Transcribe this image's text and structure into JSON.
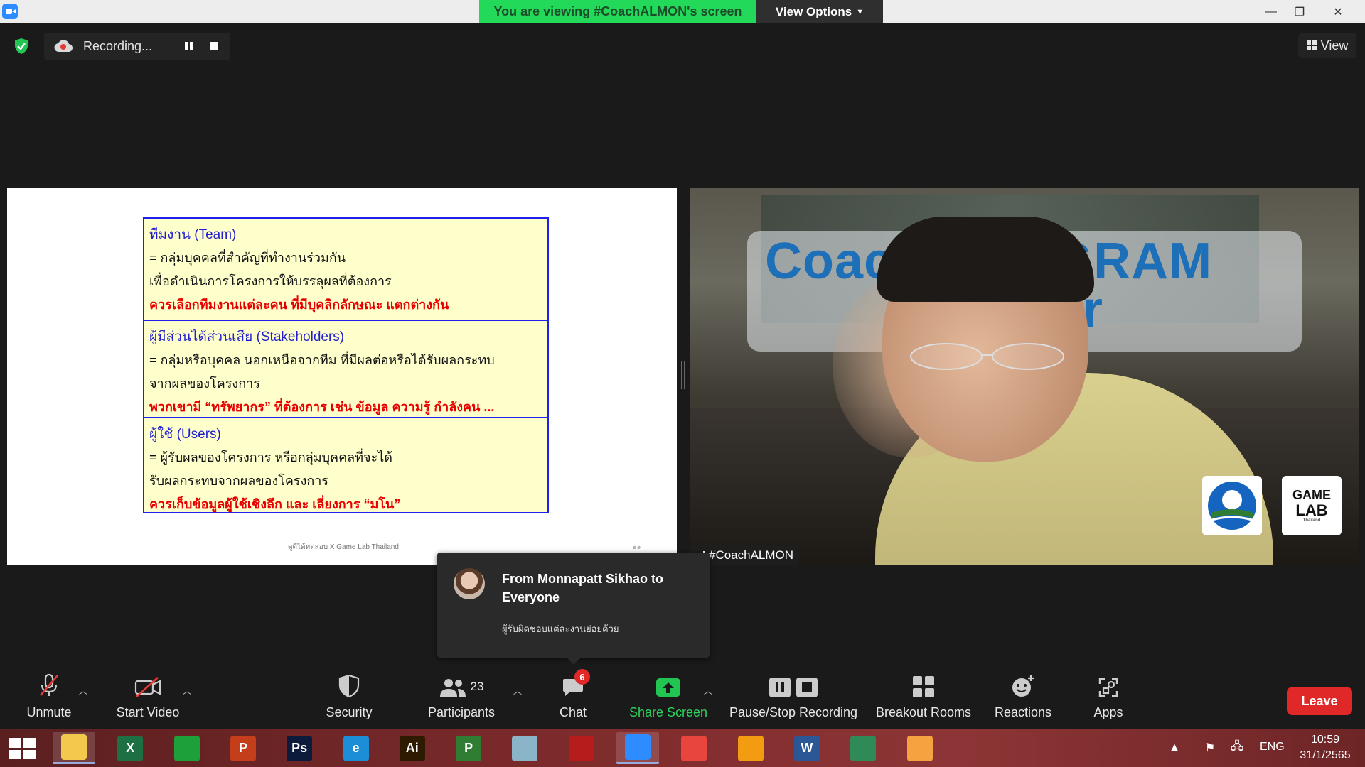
{
  "titlebar": {
    "banner": "You are viewing #CoachALMON's screen",
    "view_options": "View Options",
    "minimize": "—",
    "restore": "❐",
    "close": "✕"
  },
  "recording": {
    "label": "Recording..."
  },
  "view_button": {
    "label": "View"
  },
  "slide": {
    "sections": [
      {
        "title": "ทีมงาน (Team)",
        "lines": [
          "= กลุ่มบุคคลที่สำคัญที่ทำงานร่วมกัน",
          "เพื่อดำเนินการโครงการให้บรรลุผลที่ต้องการ"
        ],
        "highlight": "ควรเลือกทีมงานแต่ละคน ที่มีบุคลิกลักษณะ แตกต่างกัน"
      },
      {
        "title": "ผู้มีส่วนได้ส่วนเสีย (Stakeholders)",
        "lines": [
          "= กลุ่มหรือบุคคล นอกเหนือจากทีม ที่มีผลต่อหรือได้รับผลกระทบ",
          "จากผลของโครงการ"
        ],
        "highlight": "พวกเขามี “ทรัพยากร” ที่ต้องการ เช่น ข้อมูล ความรู้ กำลังคน ..."
      },
      {
        "title": "ผู้ใช้ (Users)",
        "lines": [
          "= ผู้รับผลของโครงการ หรือกลุ่มบุคคลที่จะได้",
          "รับผลกระทบจากผลของโครงการ"
        ],
        "highlight": "ควรเก็บข้อมูลผู้ใช้เชิงลึก และ เลี่ยงการ “มโน”"
      }
    ],
    "footer": "ดูดีได้ทดสอบ X Game Lab Thailand",
    "page_num": "๑๑"
  },
  "video": {
    "banner_line1": "Coach PROGRAM",
    "banner_line2": "urer",
    "participant_name": "#CoachALMON",
    "logo_text": [
      "GAME",
      "LAB",
      "Thailand"
    ]
  },
  "chat_toast": {
    "from": "From Monnapatt Sikhao to Everyone",
    "message": "ผู้รับผิดชอบแต่ละงานย่อยด้วย"
  },
  "toolbar": {
    "unmute": "Unmute",
    "start_video": "Start Video",
    "security": "Security",
    "participants": "Participants",
    "participants_count": "23",
    "chat": "Chat",
    "chat_badge": "6",
    "share_screen": "Share Screen",
    "pause_stop_recording": "Pause/Stop Recording",
    "breakout_rooms": "Breakout Rooms",
    "reactions": "Reactions",
    "apps": "Apps",
    "leave": "Leave"
  },
  "taskbar": {
    "apps": [
      {
        "name": "file-explorer",
        "label": "",
        "color": "#f2c94c"
      },
      {
        "name": "excel",
        "label": "X",
        "color": "#1d7044"
      },
      {
        "name": "store",
        "label": "",
        "color": "#1d9f3a"
      },
      {
        "name": "powerpoint",
        "label": "P",
        "color": "#c43e1c"
      },
      {
        "name": "photoshop",
        "label": "Ps",
        "color": "#0c1a3b"
      },
      {
        "name": "internet-explorer",
        "label": "e",
        "color": "#1c8ed8"
      },
      {
        "name": "illustrator",
        "label": "Ai",
        "color": "#2d1a00"
      },
      {
        "name": "project",
        "label": "P",
        "color": "#2e7d32"
      },
      {
        "name": "notes",
        "label": "",
        "color": "#8ab4c8"
      },
      {
        "name": "photoscape",
        "label": "",
        "color": "#b71c1c"
      },
      {
        "name": "zoom",
        "label": "",
        "color": "#2d8cff"
      },
      {
        "name": "chrome",
        "label": "",
        "color": "#e8453c"
      },
      {
        "name": "photos",
        "label": "",
        "color": "#f39c12"
      },
      {
        "name": "word",
        "label": "W",
        "color": "#2b5797"
      },
      {
        "name": "screen-app",
        "label": "",
        "color": "#2e8b57"
      },
      {
        "name": "snip",
        "label": "",
        "color": "#f4a340"
      }
    ],
    "lang": "ENG",
    "time": "10:59",
    "date": "31/1/2565"
  }
}
